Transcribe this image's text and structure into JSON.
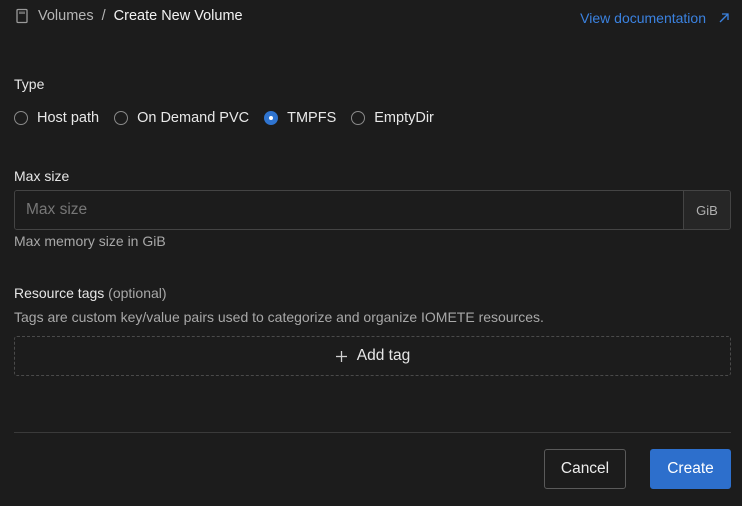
{
  "breadcrumb": {
    "icon": "volume-icon",
    "parent": "Volumes",
    "separator": "/",
    "current": "Create New Volume"
  },
  "doc_link": {
    "label": "View documentation",
    "icon": "external-link-icon"
  },
  "type_field": {
    "label": "Type",
    "options": [
      {
        "label": "Host path",
        "checked": false
      },
      {
        "label": "On Demand PVC",
        "checked": false
      },
      {
        "label": "TMPFS",
        "checked": true
      },
      {
        "label": "EmptyDir",
        "checked": false
      }
    ]
  },
  "max_size": {
    "label": "Max size",
    "placeholder": "Max size",
    "value": "",
    "addon": "GiB",
    "help": "Max memory size in GiB"
  },
  "resource_tags": {
    "label": "Resource tags",
    "optional": "(optional)",
    "help": "Tags are custom key/value pairs used to categorize and organize IOMETE resources.",
    "add_label": "Add tag",
    "add_icon": "plus-icon"
  },
  "footer": {
    "cancel_label": "Cancel",
    "create_label": "Create"
  },
  "colors": {
    "background": "#1c1c1c",
    "accent": "#2d6fcc",
    "link": "#3b82e0"
  }
}
